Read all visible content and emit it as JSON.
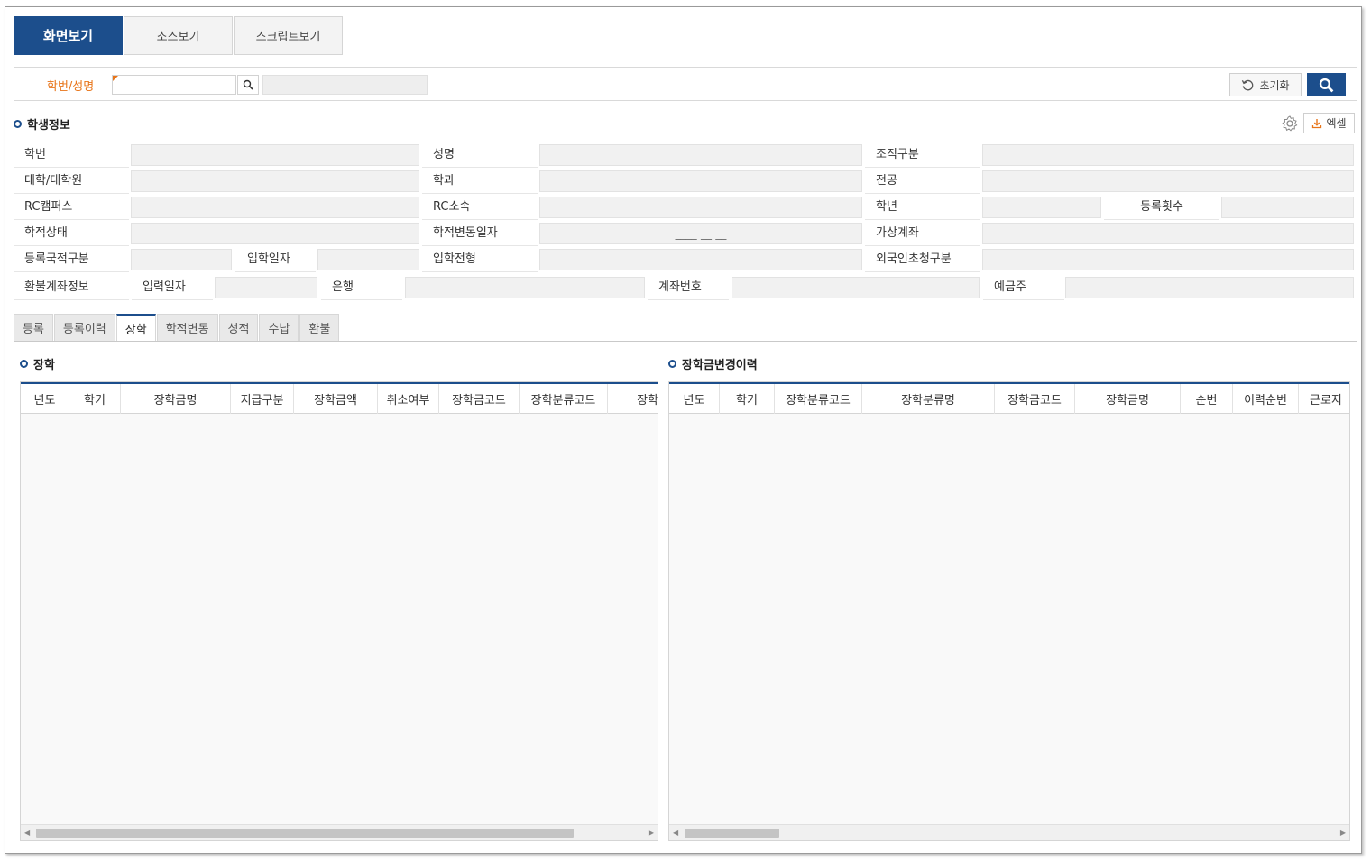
{
  "view_tabs": [
    "화면보기",
    "소스보기",
    "스크립트보기"
  ],
  "search": {
    "label": "학번/성명",
    "value": "",
    "reset_label": "초기화"
  },
  "student_info": {
    "title": "학생정보",
    "excel_label": "엑셀",
    "fields": {
      "hakbun": "학번",
      "name": "성명",
      "org": "조직구분",
      "college": "대학/대학원",
      "dept": "학과",
      "major": "전공",
      "rc_campus": "RC캠퍼스",
      "rc_affil": "RC소속",
      "grade": "학년",
      "reg_count": "등록횟수",
      "status": "학적상태",
      "status_change_date": "학적변동일자",
      "virtual_account": "가상계좌",
      "nationality": "등록국적구분",
      "admission_date": "입학일자",
      "admission_type": "입학전형",
      "foreign_invite": "외국인초청구분",
      "refund_account": "환불계좌정보",
      "input_date": "입력일자",
      "bank": "은행",
      "account_no": "계좌번호",
      "depositor": "예금주"
    },
    "status_change_date_value": "____-__-__"
  },
  "bottom_tabs": [
    "등록",
    "등록이력",
    "장학",
    "학적변동",
    "성적",
    "수납",
    "환불"
  ],
  "active_bottom_tab": "장학",
  "scholarship": {
    "title": "장학",
    "columns": [
      "년도",
      "학기",
      "장학금명",
      "지급구분",
      "장학금액",
      "취소여부",
      "장학금코드",
      "장학분류코드",
      "장학"
    ]
  },
  "history": {
    "title": "장학금변경이력",
    "columns": [
      "년도",
      "학기",
      "장학분류코드",
      "장학분류명",
      "장학금코드",
      "장학금명",
      "순번",
      "이력순번",
      "근로지"
    ]
  },
  "colors": {
    "primary": "#1c4e8c",
    "required_label": "#e8751a"
  }
}
